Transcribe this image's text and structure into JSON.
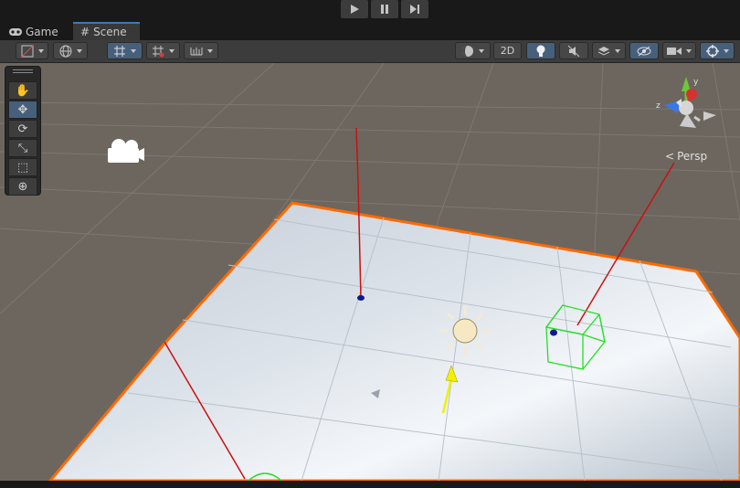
{
  "tabs": [
    {
      "label": "Game",
      "icon": "gamepad-icon",
      "active": false
    },
    {
      "label": "Scene",
      "icon": "grid-hash-icon",
      "active": true
    }
  ],
  "toolbar": {
    "mode_2d_label": "2D"
  },
  "gizmo": {
    "projection_label": "Persp",
    "axes": {
      "y": "y",
      "z": "z"
    }
  },
  "colors": {
    "selection_outline": "#ff6a00",
    "active_button": "#46607c",
    "collider_green": "#22e022"
  }
}
